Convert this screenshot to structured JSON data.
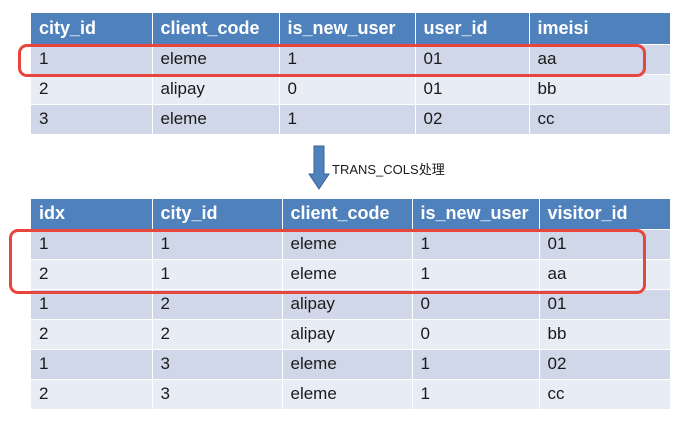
{
  "top_table": {
    "columns": [
      "city_id",
      "client_code",
      "is_new_user",
      "user_id",
      "imeisi"
    ],
    "rows": [
      [
        "1",
        "eleme",
        "1",
        "01",
        "aa"
      ],
      [
        "2",
        "alipay",
        "0",
        "01",
        "bb"
      ],
      [
        "3",
        "eleme",
        "1",
        "02",
        "cc"
      ]
    ]
  },
  "arrow": {
    "label": "TRANS_COLS处理"
  },
  "bottom_table": {
    "columns": [
      "idx",
      "city_id",
      "client_code",
      "is_new_user",
      "visitor_id"
    ],
    "rows": [
      [
        "1",
        "1",
        "eleme",
        "1",
        "01"
      ],
      [
        "2",
        "1",
        "eleme",
        "1",
        "aa"
      ],
      [
        "1",
        "2",
        "alipay",
        "0",
        "01"
      ],
      [
        "2",
        "2",
        "alipay",
        "0",
        "bb"
      ],
      [
        "1",
        "3",
        "eleme",
        "1",
        "02"
      ],
      [
        "2",
        "3",
        "eleme",
        "1",
        "cc"
      ]
    ]
  },
  "colors": {
    "header": "#4f81bd",
    "row_odd": "#cfd7e8",
    "row_even": "#e8ecf4",
    "highlight": "#e8453c",
    "arrow": "#4f81bd"
  }
}
